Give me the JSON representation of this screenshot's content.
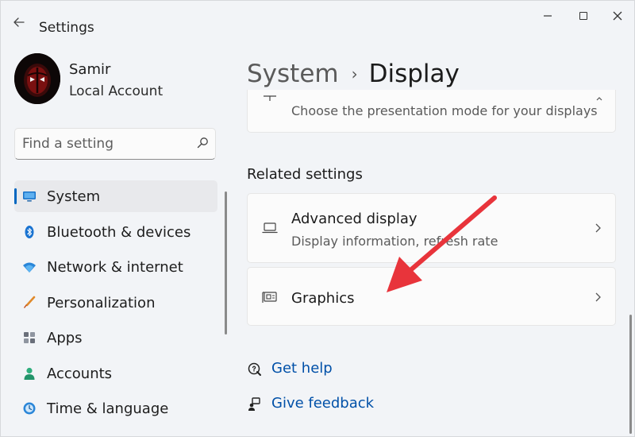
{
  "window": {
    "title": "Settings"
  },
  "profile": {
    "name": "Samir",
    "account_type": "Local Account"
  },
  "search": {
    "placeholder": "Find a setting",
    "value": ""
  },
  "nav": {
    "items": [
      {
        "label": "System",
        "icon": "monitor-icon",
        "active": true
      },
      {
        "label": "Bluetooth & devices",
        "icon": "bluetooth-icon",
        "active": false
      },
      {
        "label": "Network & internet",
        "icon": "wifi-icon",
        "active": false
      },
      {
        "label": "Personalization",
        "icon": "brush-icon",
        "active": false
      },
      {
        "label": "Apps",
        "icon": "apps-icon",
        "active": false
      },
      {
        "label": "Accounts",
        "icon": "person-icon",
        "active": false
      },
      {
        "label": "Time & language",
        "icon": "globe-clock-icon",
        "active": false
      }
    ]
  },
  "breadcrumb": {
    "parent": "System",
    "separator": "›",
    "current": "Display"
  },
  "cards": {
    "presentation": {
      "description": "Choose the presentation mode for your displays"
    },
    "advanced_display": {
      "title": "Advanced display",
      "description": "Display information, refresh rate"
    },
    "graphics": {
      "title": "Graphics"
    }
  },
  "related_settings": {
    "heading": "Related settings"
  },
  "links": {
    "get_help": "Get help",
    "give_feedback": "Give feedback"
  },
  "colors": {
    "accent": "#0067c0",
    "link": "#0050a8",
    "annotation_arrow": "#e8343b",
    "window_background": "#f2f4f7",
    "card_background": "#fbfbfb"
  }
}
